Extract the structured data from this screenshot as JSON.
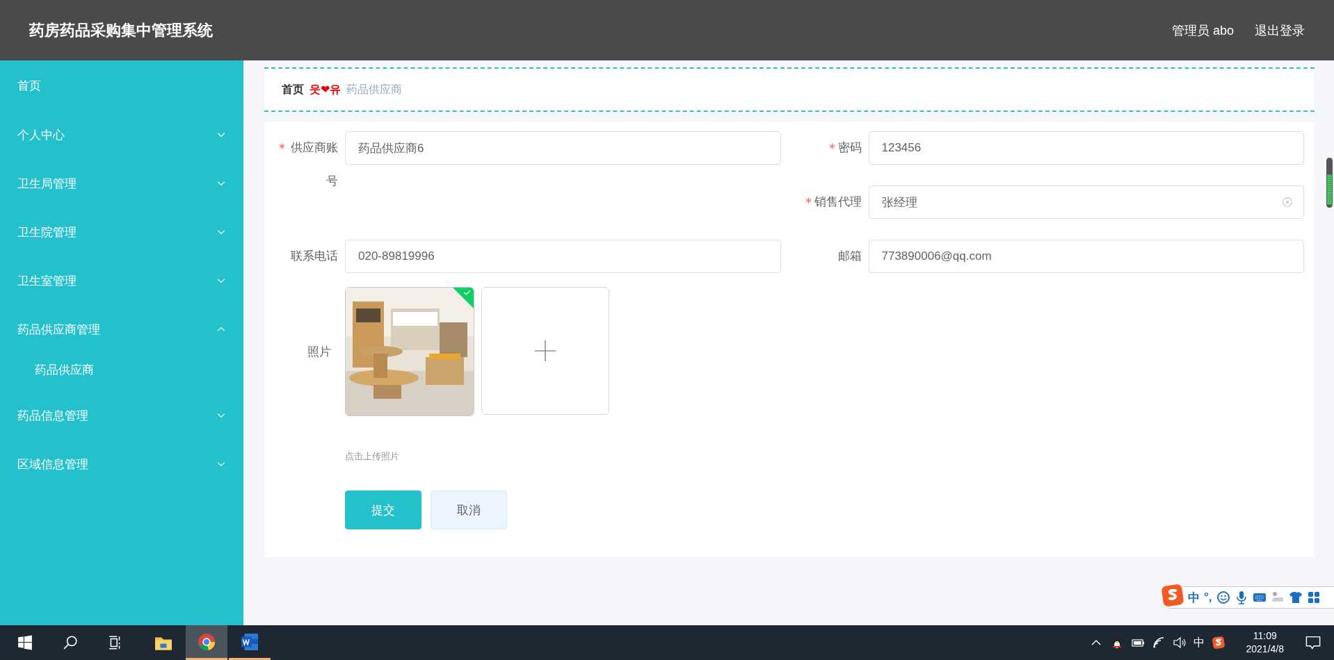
{
  "header": {
    "title": "药房药品采购集中管理系统",
    "user": "管理员 abo",
    "logout": "退出登录"
  },
  "sidebar": {
    "items": [
      {
        "label": "首页",
        "expandable": false
      },
      {
        "label": "个人中心",
        "expandable": true,
        "expanded": false
      },
      {
        "label": "卫生局管理",
        "expandable": true,
        "expanded": false
      },
      {
        "label": "卫生院管理",
        "expandable": true,
        "expanded": false
      },
      {
        "label": "卫生室管理",
        "expandable": true,
        "expanded": false
      },
      {
        "label": "药品供应商管理",
        "expandable": true,
        "expanded": true,
        "children": [
          {
            "label": "药品供应商"
          }
        ]
      },
      {
        "label": "药品信息管理",
        "expandable": true,
        "expanded": false
      },
      {
        "label": "区域信息管理",
        "expandable": true,
        "expanded": false
      }
    ]
  },
  "breadcrumb": {
    "home": "首页",
    "separator": "웃❤유",
    "current": "药品供应商"
  },
  "form": {
    "rows": [
      {
        "left": {
          "label": "供应商账号",
          "required": true,
          "value": "药品供应商6"
        },
        "right": {
          "label": "密码",
          "required": true,
          "value": "123456"
        }
      },
      {
        "right": {
          "label": "销售代理",
          "required": true,
          "value": "张经理",
          "clearable": true
        }
      },
      {
        "left": {
          "label": "联系电话",
          "required": false,
          "value": "020-89819996"
        },
        "right": {
          "label": "邮箱",
          "required": false,
          "value": "773890006@qq.com"
        }
      }
    ],
    "photo": {
      "label": "照片",
      "uploads": [
        {
          "kind": "picture",
          "uploaded": true
        }
      ],
      "hint": "点击上传照片"
    },
    "buttons": [
      {
        "label": "提交",
        "kind": "primary"
      },
      {
        "label": "取消",
        "kind": "plain"
      }
    ]
  },
  "ime_bar": {
    "mode": "中",
    "punctuation": "°,"
  },
  "taskbar": {
    "apps": [
      {
        "kind": "explorer",
        "running": false,
        "active": false
      },
      {
        "kind": "browser",
        "running": true,
        "active": true
      },
      {
        "kind": "word",
        "running": true,
        "active": false
      }
    ],
    "input_indicator": "中",
    "time": "11:09",
    "date": "2021/4/8"
  }
}
